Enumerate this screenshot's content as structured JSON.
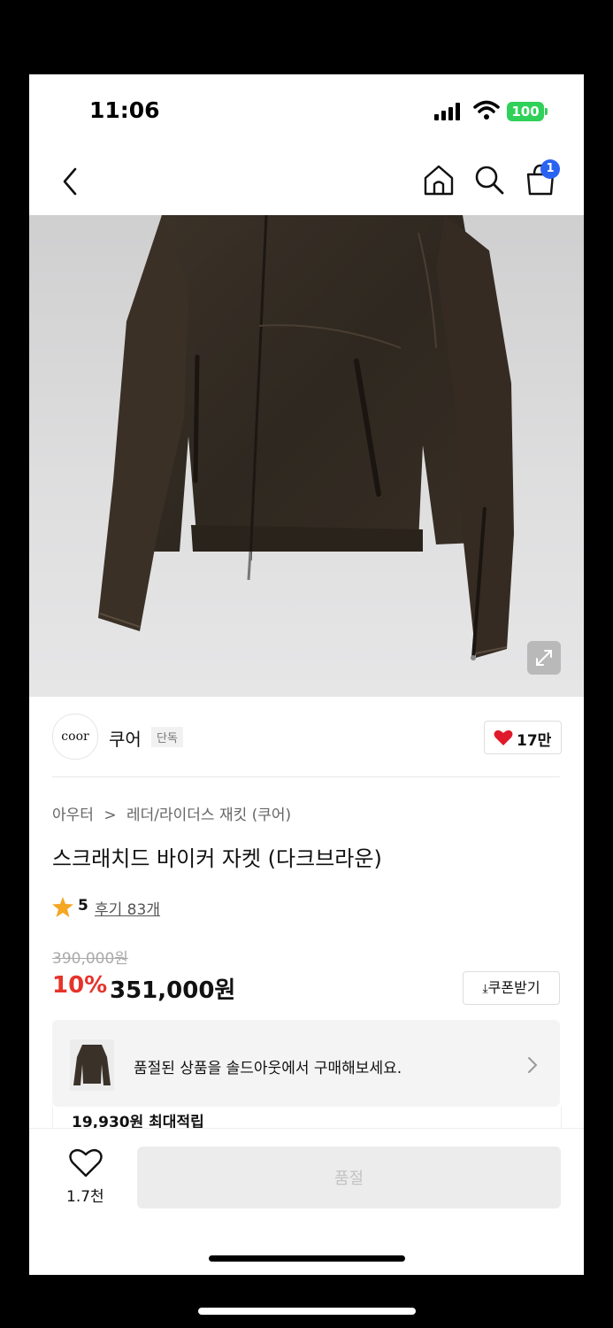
{
  "status_bar": {
    "time": "11:06",
    "battery": "100"
  },
  "nav": {
    "cart_count": "1"
  },
  "brand": {
    "logo_text": "coor",
    "name": "쿠어",
    "tag": "단독",
    "likes": "17만"
  },
  "product": {
    "breadcrumb_category": "아우터",
    "breadcrumb_separator": ">",
    "breadcrumb_sub": "레더/라이더스 재킷 (쿠어)",
    "title": "스크래치드 바이커 자켓 (다크브라운)",
    "rating": "5",
    "reviews": "후기 83개",
    "original_price": "390,000원",
    "discount": "10%",
    "price": "351,000원",
    "coupon_label": "쿠폰받기"
  },
  "soldout_banner": {
    "text": "품절된 상품을 솔드아웃에서 구매해보세요.",
    "points": "19,930원 최대적립"
  },
  "bottom": {
    "wish_count": "1.7천",
    "buy_label": "품절"
  },
  "colors": {
    "accent_red": "#e6332a",
    "badge_blue": "#2a62f2",
    "battery_green": "#30d158"
  }
}
